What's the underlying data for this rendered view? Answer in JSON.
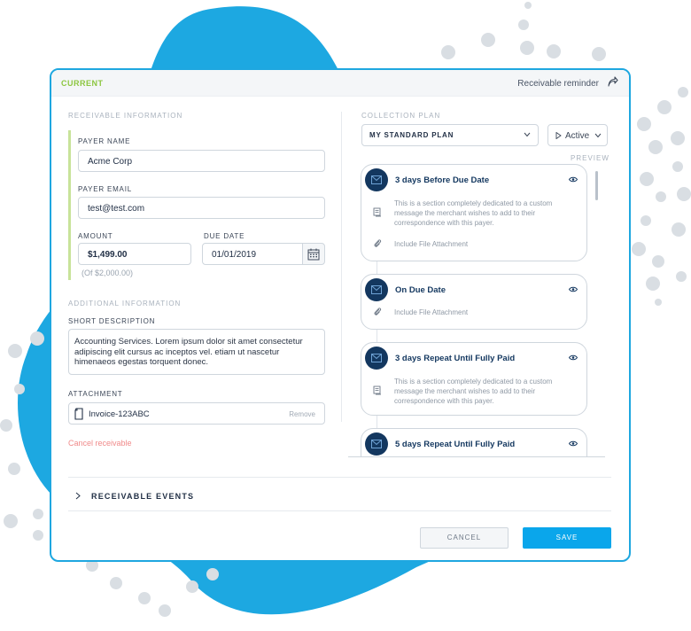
{
  "colors": {
    "accent_blue": "#1ea7e0",
    "save_blue": "#0aa6eb",
    "current_green": "#8cc63f",
    "navy": "#13375f",
    "danger": "#f08a8a"
  },
  "header": {
    "status": "CURRENT",
    "reminder_label": "Receivable reminder",
    "share_icon": "share-icon"
  },
  "receivable": {
    "section_title": "RECEIVABLE INFORMATION",
    "payer_name": {
      "label": "PAYER NAME",
      "value": "Acme Corp"
    },
    "payer_email": {
      "label": "PAYER EMAIL",
      "value": "test@test.com"
    },
    "amount": {
      "label": "AMOUNT",
      "value": "$1,499.00",
      "note": "(Of  $2,000.00)"
    },
    "due_date": {
      "label": "DUE DATE",
      "value": "01/01/2019",
      "icon": "calendar-icon"
    }
  },
  "additional": {
    "section_title": "ADDITIONAL INFORMATION",
    "short_description": {
      "label": "SHORT DESCRIPTION",
      "value": "Accounting Services. Lorem ipsum dolor sit amet consectetur adipiscing elit cursus ac inceptos vel. etiam ut nascetur himenaeos egestas torquent donec."
    },
    "attachment": {
      "label": "ATTACHMENT",
      "file_name": "Invoice-123ABC",
      "remove_label": "Remove"
    },
    "cancel_label": "Cancel receivable"
  },
  "collection_plan": {
    "section_title": "COLLECTION PLAN",
    "selected_plan": "MY STANDARD PLAN",
    "status": "Active",
    "preview_label": "PREVIEW",
    "steps": [
      {
        "title": "3 days Before Due Date",
        "message": "This is a section completely dedicated to a custom message the merchant wishes to add to their correspondence with this payer.",
        "attachment": "Include File Attachment"
      },
      {
        "title": "On Due Date",
        "attachment": "Include File Attachment"
      },
      {
        "title": "3 days Repeat Until Fully Paid",
        "message": "This is a section completely dedicated to a custom message the merchant wishes to add to their correspondence with this payer."
      },
      {
        "title": "5 days Repeat Until Fully Paid"
      }
    ]
  },
  "events": {
    "label": "RECEIVABLE EVENTS"
  },
  "footer": {
    "cancel_label": "CANCEL",
    "save_label": "SAVE"
  }
}
